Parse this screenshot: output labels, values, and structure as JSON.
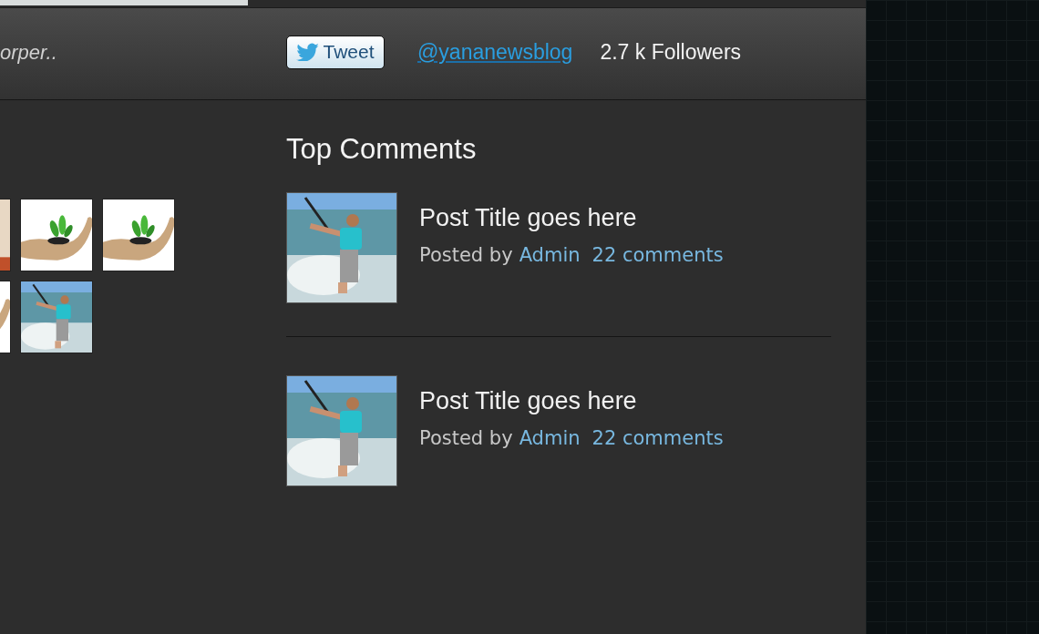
{
  "header": {
    "excerpt": "orper..",
    "tweet_button": "Tweet",
    "handle": "@yananewsblog",
    "followers": "2.7 k Followers"
  },
  "top_comments": {
    "title": "Top Comments",
    "posts": [
      {
        "title": "Post Title goes here",
        "posted_by": "Posted by",
        "author": "Admin",
        "comments": "22 comments"
      },
      {
        "title": "Post Title goes here",
        "posted_by": "Posted by",
        "author": "Admin",
        "comments": "22 comments"
      }
    ]
  }
}
